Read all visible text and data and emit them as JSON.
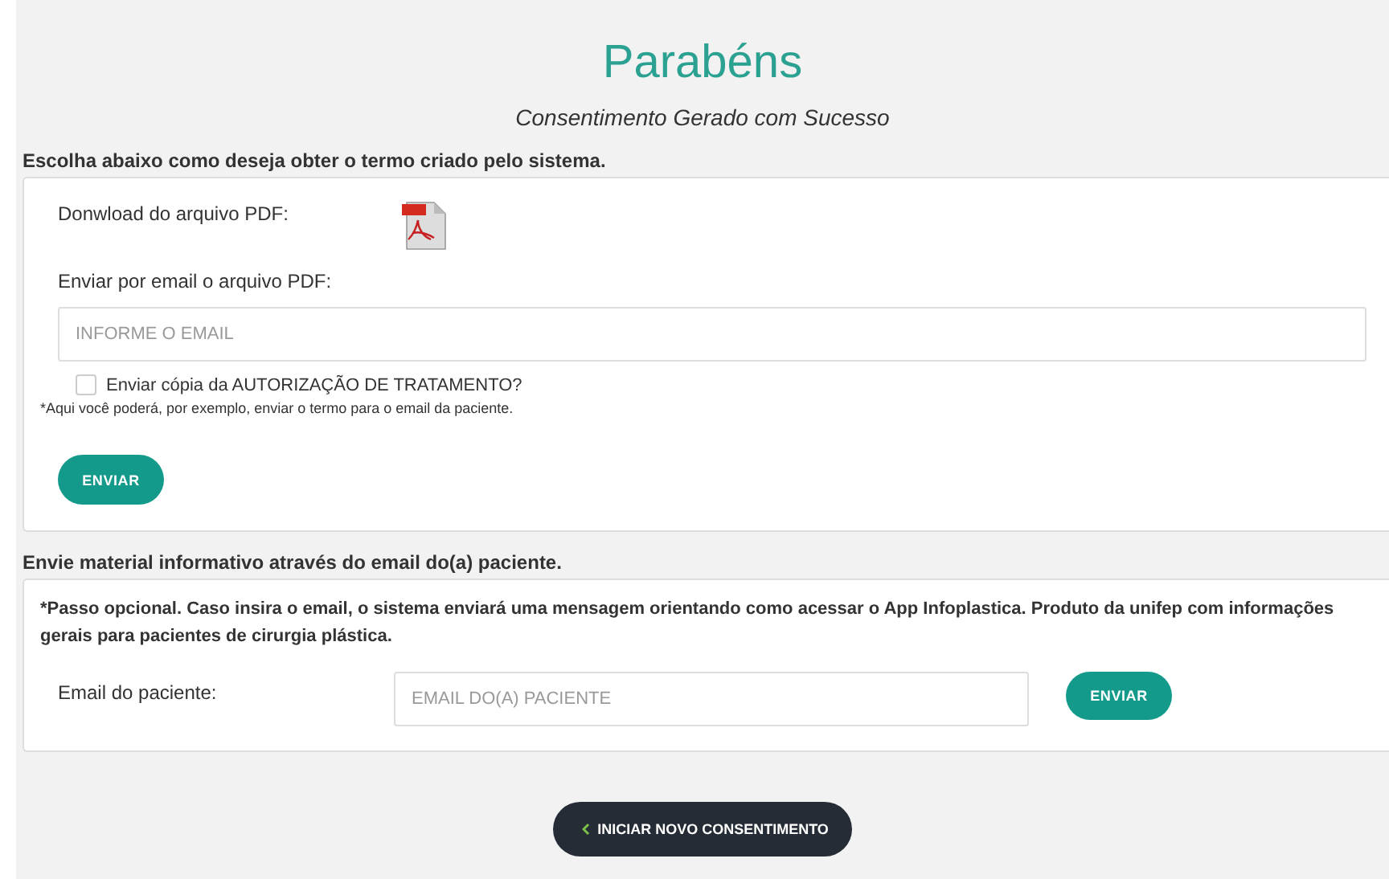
{
  "title": "Parabéns",
  "subtitle": "Consentimento Gerado com Sucesso",
  "pdf_section": {
    "heading": "Escolha abaixo como deseja obter o termo criado pelo sistema.",
    "download_label": "Donwload do arquivo PDF:",
    "email_label": "Enviar por email o arquivo PDF:",
    "email_field": {
      "placeholder": "INFORME O EMAIL"
    },
    "checkbox": {
      "label": "Enviar cópia da AUTORIZAÇÃO DE TRATAMENTO?",
      "checked": false
    },
    "note": "*Aqui você poderá, por exemplo, enviar o termo para o email da paciente.",
    "button": "ENVIAR"
  },
  "material_section": {
    "heading": "Envie material informativo através do email do(a) paciente.",
    "note": "*Passo opcional. Caso insira o email, o sistema enviará uma mensagem orientando como acessar o App Infoplastica. Produto da unifep com informações gerais para pacientes de cirurgia plástica.",
    "email_label": "Email do paciente:",
    "email_field": {
      "placeholder": "EMAIL DO(A) PACIENTE"
    },
    "button": "ENVIAR"
  },
  "new_button": {
    "label": "INICIAR NOVO CONSENTIMENTO"
  }
}
